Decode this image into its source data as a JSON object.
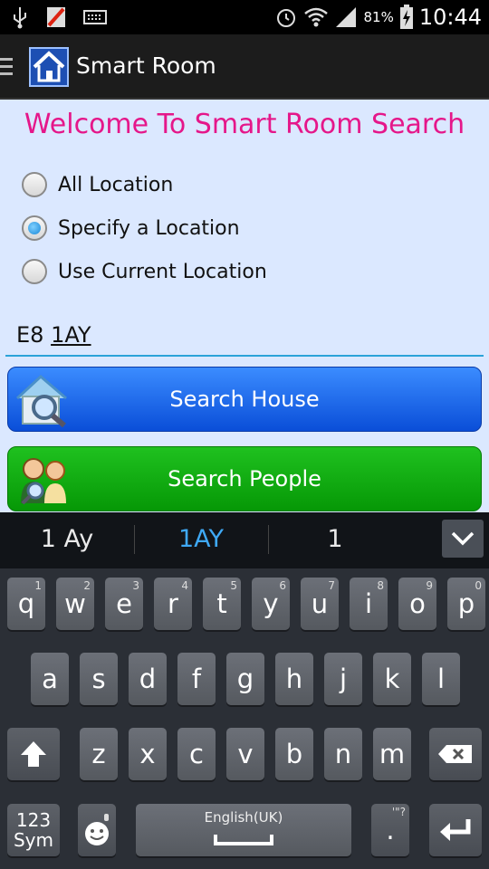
{
  "status_bar": {
    "battery": "81%",
    "time": "10:44"
  },
  "app_bar": {
    "title": "Smart Room"
  },
  "content": {
    "welcome": "Welcome To Smart Room Search",
    "radio_options": [
      {
        "label": "All Location",
        "checked": false
      },
      {
        "label": "Specify a Location",
        "checked": true
      },
      {
        "label": "Use Current Location",
        "checked": false
      }
    ],
    "location_input": {
      "prefix": "E8 ",
      "composing": "1AY"
    },
    "buttons": {
      "search_house": "Search House",
      "search_people": "Search People"
    }
  },
  "keyboard": {
    "suggestions": [
      "1 Ay",
      "1AY",
      "1"
    ],
    "row1": [
      {
        "key": "q",
        "hint": "1"
      },
      {
        "key": "w",
        "hint": "2"
      },
      {
        "key": "e",
        "hint": "3"
      },
      {
        "key": "r",
        "hint": "4"
      },
      {
        "key": "t",
        "hint": "5"
      },
      {
        "key": "y",
        "hint": "6"
      },
      {
        "key": "u",
        "hint": "7"
      },
      {
        "key": "i",
        "hint": "8"
      },
      {
        "key": "o",
        "hint": "9"
      },
      {
        "key": "p",
        "hint": "0"
      }
    ],
    "row2": [
      "a",
      "s",
      "d",
      "f",
      "g",
      "h",
      "j",
      "k",
      "l"
    ],
    "row3": [
      "z",
      "x",
      "c",
      "v",
      "b",
      "n",
      "m"
    ],
    "sym_label_1": "123",
    "sym_label_2": "Sym",
    "space_label": "English(UK)",
    "period": ".",
    "period_hint": "'\"?"
  }
}
